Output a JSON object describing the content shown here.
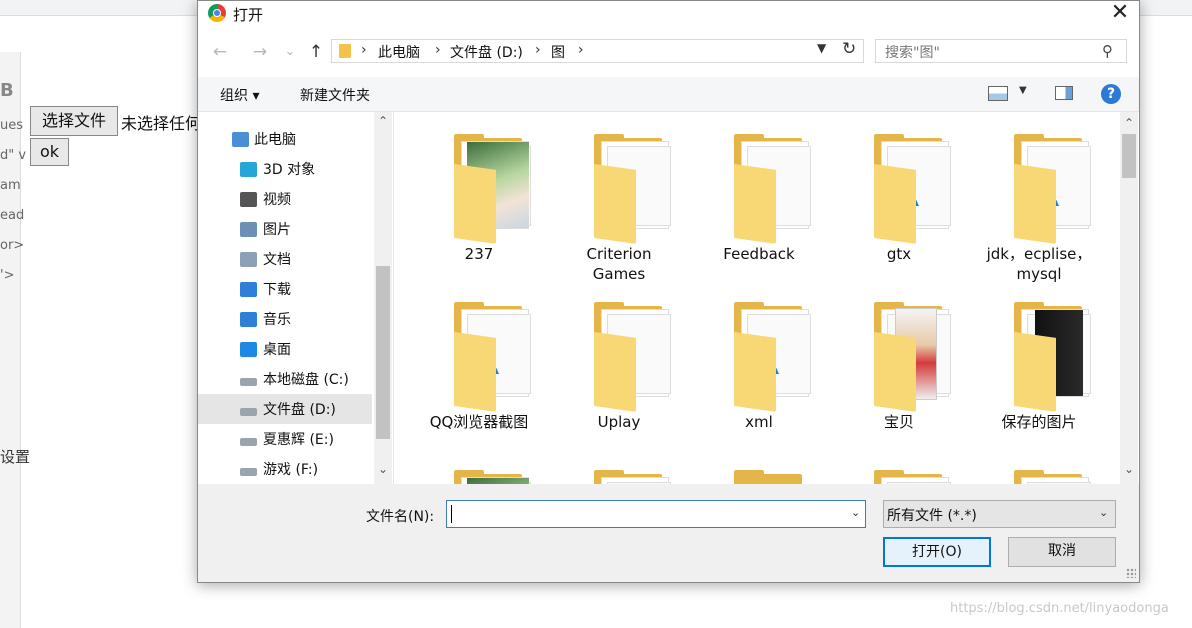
{
  "background_page": {
    "fragments": [
      "B",
      "ues",
      "d\" v",
      "am",
      "ead",
      "or>",
      "'>",
      "设置"
    ],
    "file_button": "选择文件",
    "file_status": "未选择任何文件",
    "ok_button": "ok",
    "watermark": "https://blog.csdn.net/linyaodonga"
  },
  "dialog": {
    "title": "打开",
    "close_symbol": "✕",
    "nav": {
      "back": "←",
      "forward": "→",
      "recent": "⌄",
      "up": "↑"
    },
    "breadcrumb": [
      "此电脑",
      "文件盘 (D:)",
      "图"
    ],
    "search": {
      "placeholder": "搜索\"图\"",
      "icon": "search-icon"
    },
    "commands": {
      "organize": "组织 ▾",
      "new_folder": "新建文件夹",
      "help": "?"
    },
    "tree": [
      {
        "label": "此电脑",
        "icon": "computer-icon",
        "color": "#4a8fd6"
      },
      {
        "label": "3D 对象",
        "icon": "3d-objects-icon",
        "color": "#26a5d9"
      },
      {
        "label": "视频",
        "icon": "video-icon",
        "color": "#555555"
      },
      {
        "label": "图片",
        "icon": "pictures-icon",
        "color": "#6b8fb5"
      },
      {
        "label": "文档",
        "icon": "documents-icon",
        "color": "#8ca0b8"
      },
      {
        "label": "下载",
        "icon": "downloads-icon",
        "color": "#2f7fd9"
      },
      {
        "label": "音乐",
        "icon": "music-icon",
        "color": "#2f7fd9"
      },
      {
        "label": "桌面",
        "icon": "desktop-icon",
        "color": "#1e88e5"
      },
      {
        "label": "本地磁盘 (C:)",
        "icon": "drive-c-icon",
        "color": "#9aa4ad"
      },
      {
        "label": "文件盘 (D:)",
        "icon": "drive-icon",
        "color": "#9aa4ad",
        "selected": true
      },
      {
        "label": "夏惠辉 (E:)",
        "icon": "drive-icon",
        "color": "#9aa4ad"
      },
      {
        "label": "游戏 (F:)",
        "icon": "drive-icon",
        "color": "#9aa4ad"
      }
    ],
    "files": [
      {
        "name": "237",
        "kind": "photo"
      },
      {
        "name": "Criterion Games",
        "kind": "docs"
      },
      {
        "name": "Feedback",
        "kind": "docs"
      },
      {
        "name": "gtx",
        "kind": "images"
      },
      {
        "name": "jdk，ecplise，mysql",
        "kind": "images"
      },
      {
        "name": "QQ浏览器截图",
        "kind": "images"
      },
      {
        "name": "Uplay",
        "kind": "docs"
      },
      {
        "name": "xml",
        "kind": "images"
      },
      {
        "name": "宝贝",
        "kind": "magazine"
      },
      {
        "name": "保存的图片",
        "kind": "dark"
      },
      {
        "name": "",
        "kind": "photo2"
      },
      {
        "name": "",
        "kind": "docs"
      },
      {
        "name": "",
        "kind": "plain"
      },
      {
        "name": "",
        "kind": "docs"
      },
      {
        "name": "",
        "kind": "docs"
      }
    ],
    "filename_label": "文件名(N):",
    "filename_value": "",
    "filetype": "所有文件 (*.*)",
    "open_button": "打开(O)",
    "cancel_button": "取消"
  }
}
